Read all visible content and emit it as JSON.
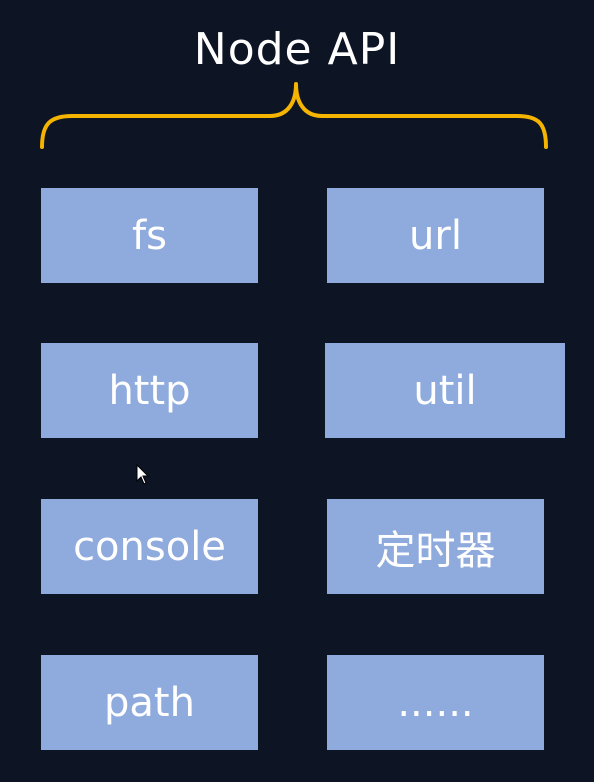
{
  "title": "Node API",
  "boxes": [
    {
      "label": "fs"
    },
    {
      "label": "url"
    },
    {
      "label": "http"
    },
    {
      "label": "util"
    },
    {
      "label": "console"
    },
    {
      "label": "定时器"
    },
    {
      "label": "path"
    },
    {
      "label": "......"
    }
  ],
  "colors": {
    "background": "#0d1424",
    "brace": "#f5b400",
    "box": "#8faadc",
    "text": "#ffffff"
  }
}
